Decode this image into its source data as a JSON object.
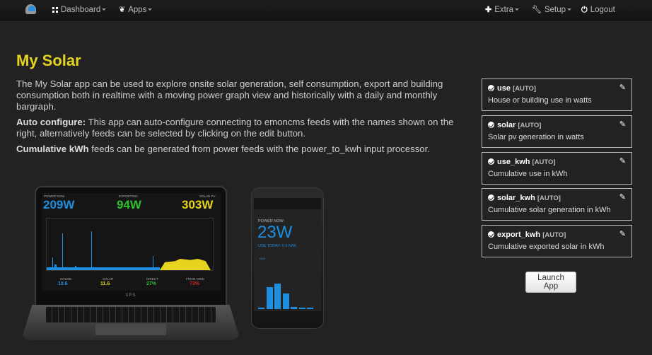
{
  "navbar": {
    "logo_icon": "emoncms-logo-icon",
    "left": [
      {
        "label": "Dashboard",
        "icon": "dashboard-grid-icon",
        "dropdown": true
      },
      {
        "label": "Apps",
        "icon": "leaf-icon",
        "dropdown": true
      }
    ],
    "right": [
      {
        "label": "Extra",
        "icon": "plus-icon",
        "dropdown": true
      },
      {
        "label": "Setup",
        "icon": "wrench-icon",
        "dropdown": true
      },
      {
        "label": "Logout",
        "icon": "power-icon",
        "dropdown": false
      }
    ]
  },
  "page": {
    "title": "My Solar",
    "intro": "The My Solar app can be used to explore onsite solar generation, self consumption, export and building consumption both in realtime with a moving power graph view and historically with a daily and monthly bargraph.",
    "auto_configure_label": "Auto configure:",
    "auto_configure_text": " This app can auto-configure connecting to emoncms feeds with the names shown on the right, alternatively feeds can be selected by clicking on the edit button.",
    "cumulative_label": "Cumulative kWh",
    "cumulative_text": " feeds can be generated from power feeds with the power_to_kwh input processor."
  },
  "feeds": [
    {
      "name": "use",
      "tag": "[AUTO]",
      "description": "House or building use in watts"
    },
    {
      "name": "solar",
      "tag": "[AUTO]",
      "description": "Solar pv generation in watts"
    },
    {
      "name": "use_kwh",
      "tag": "[AUTO]",
      "description": "Cumulative use in kWh"
    },
    {
      "name": "solar_kwh",
      "tag": "[AUTO]",
      "description": "Cumulative solar generation in kWh"
    },
    {
      "name": "export_kwh",
      "tag": "[AUTO]",
      "description": "Cumulative exported solar in kWh"
    }
  ],
  "launch_button": "Launch App",
  "laptop_preview": {
    "power_now_label": "POWER NOW",
    "power_now": "209W",
    "exporting_label": "EXPORTING:",
    "exporting": "94W",
    "solar_pv_label": "SOLAR PV",
    "solar_pv": "303W",
    "house_label": "HOUSE",
    "house": "10.6",
    "solar_label": "SOLAR",
    "solar": "11.6",
    "direct_label": "DIRECT",
    "direct": "27%",
    "from_grid_label": "FROM GRID",
    "from_grid": "73%",
    "brand": "XPS",
    "colors": {
      "blue": "#1e8fe0",
      "green": "#2ec02e",
      "yellow": "#e6d41f",
      "red": "#d42a2a"
    }
  },
  "phone_preview": {
    "power_now_label": "POWER NOW:",
    "power_now": "23W",
    "use_today": "USE TODAY: 0.5 kWh",
    "kwh_label": "kWh",
    "bars_kwh": [
      0.4,
      7,
      8,
      5,
      0.6,
      0.5,
      0.3
    ]
  }
}
